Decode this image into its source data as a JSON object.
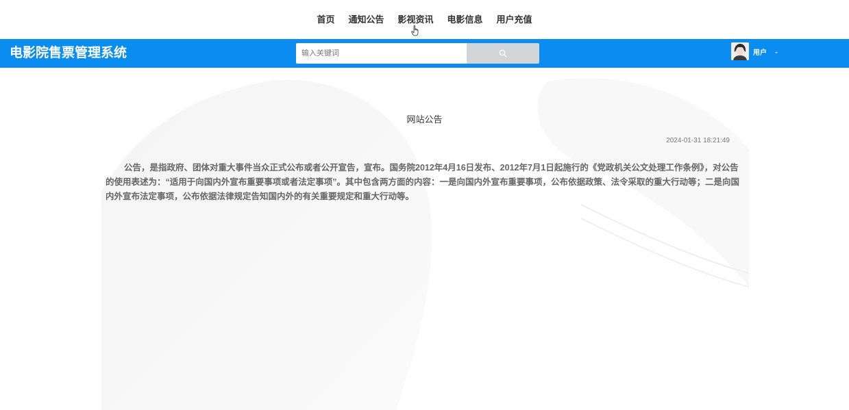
{
  "nav": {
    "items": [
      {
        "label": "首页"
      },
      {
        "label": "通知公告"
      },
      {
        "label": "影视资讯"
      },
      {
        "label": "电影信息"
      },
      {
        "label": "用户充值"
      }
    ]
  },
  "header": {
    "title": "电影院售票管理系统",
    "search": {
      "placeholder": "输入关键词",
      "value": "",
      "icon": "search-icon"
    },
    "user": {
      "name": "用户",
      "avatar_icon": "avatar",
      "caret_icon": "chevron-down-icon"
    }
  },
  "article": {
    "title": "网站公告",
    "date": "2024-01-31 18:21:49",
    "body": "公告，是指政府、团体对重大事件当众正式公布或者公开宣告，宣布。国务院2012年4月16日发布、2012年7月1日起施行的《党政机关公文处理工作条例》，对公告的使用表述为：“适用于向国内外宣布重要事项或者法定事项”。其中包含两方面的内容：一是向国内外宣布重要事项，公布依据政策、法令采取的重大行动等；二是向国内外宣布法定事项，公布依据法律规定告知国内外的有关重要规定和重大行动等。"
  },
  "colors": {
    "header_bg": "#0a8cf0",
    "search_button_bg": "#d3d6d9"
  }
}
